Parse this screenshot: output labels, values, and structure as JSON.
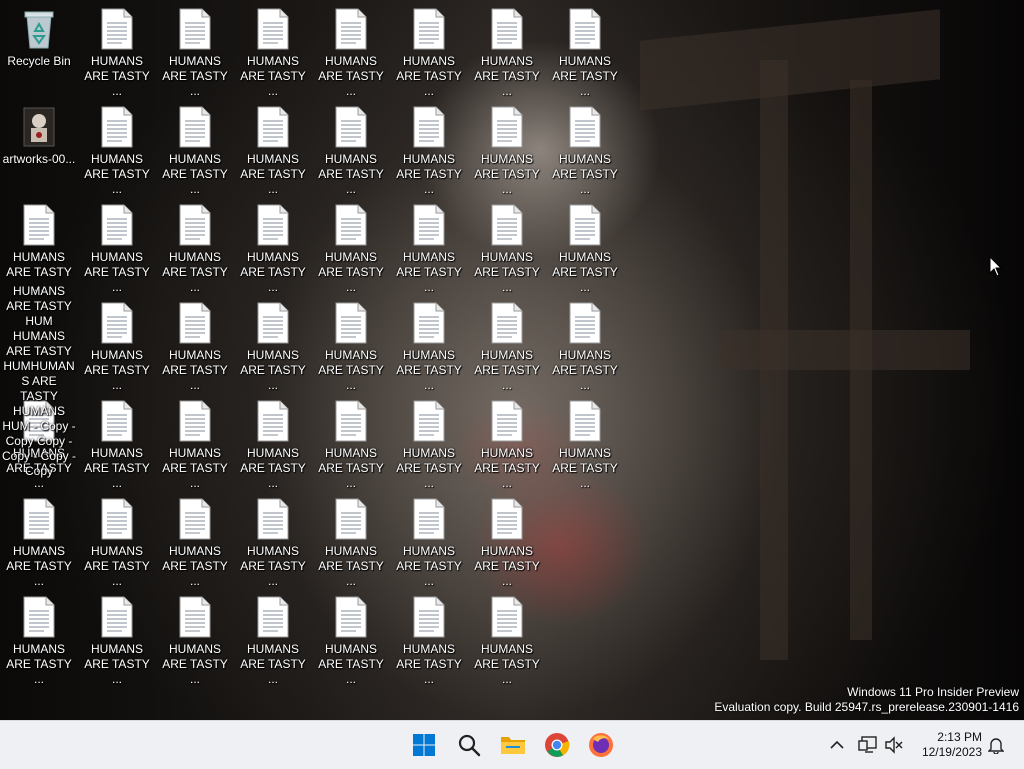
{
  "desktop": {
    "recycle_bin_label": "Recycle Bin",
    "artwork_label": "artworks-00...",
    "file_label": "HUMANS ARE TASTY ...",
    "overlap_label": "HUMANS ARE TASTY HUM HUMANS ARE TASTY HUMHUMAN S ARE TASTY HUMANS HUM - Copy - Copy Copy - Copy - Copy - Copy"
  },
  "watermark": {
    "line1": "Windows 11 Pro Insider Preview",
    "line2": "Evaluation copy. Build 25947.rs_prerelease.230901-1416"
  },
  "taskbar": {
    "apps": [
      {
        "name": "start-button",
        "icon": "windows-logo-icon"
      },
      {
        "name": "search-button",
        "icon": "search-icon"
      },
      {
        "name": "file-explorer-button",
        "icon": "folder-icon"
      },
      {
        "name": "chrome-button",
        "icon": "chrome-icon"
      },
      {
        "name": "firefox-button",
        "icon": "firefox-icon"
      }
    ],
    "time": "2:13 PM",
    "date": "12/19/2023"
  },
  "colors": {
    "taskbar_bg": "#eef0f3",
    "windows_blue": "#0078d4"
  }
}
